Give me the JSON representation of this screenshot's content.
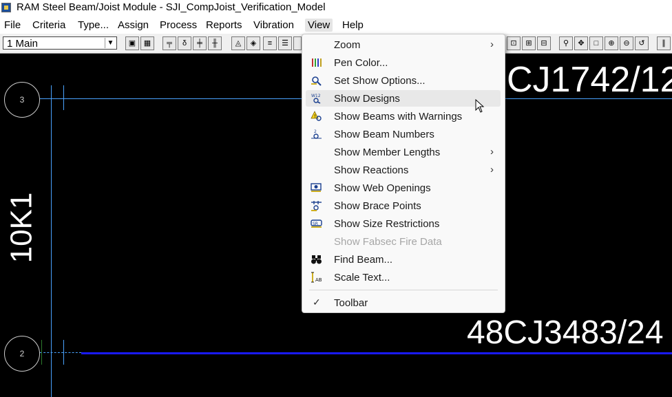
{
  "window": {
    "title": "RAM Steel Beam/Joist Module - SJI_CompJoist_Verification_Model"
  },
  "menubar": {
    "items": [
      "File",
      "Criteria",
      "Type...",
      "Assign",
      "Process",
      "Reports",
      "Vibration",
      "View",
      "Help"
    ],
    "active": "View"
  },
  "toolbar": {
    "story_value": "1   Main"
  },
  "canvas": {
    "grid_bubbles": [
      "3",
      "2"
    ],
    "beam_label_top": "CJ1742/12",
    "beam_label_bottom": "48CJ3483/24",
    "joist_label": "10K1",
    "colors": {
      "background": "#000000",
      "grid": "#4aa3ff",
      "beam": "#1a1aff",
      "text": "#ffffff"
    }
  },
  "view_menu": {
    "items": [
      {
        "label": "Zoom",
        "icon": "none",
        "submenu": true
      },
      {
        "label": "Pen Color...",
        "icon": "pen-color-icon"
      },
      {
        "label": "Set Show Options...",
        "icon": "show-options-icon"
      },
      {
        "label": "Show Designs",
        "icon": "show-designs-icon",
        "hover": true
      },
      {
        "label": "Show Beams with Warnings",
        "icon": "warning-icon"
      },
      {
        "label": "Show Beam Numbers",
        "icon": "beam-numbers-icon"
      },
      {
        "label": "Show Member Lengths",
        "icon": "none",
        "submenu": true
      },
      {
        "label": "Show Reactions",
        "icon": "none",
        "submenu": true
      },
      {
        "label": "Show Web Openings",
        "icon": "web-openings-icon"
      },
      {
        "label": "Show Brace Points",
        "icon": "brace-points-icon"
      },
      {
        "label": "Show Size Restrictions",
        "icon": "size-restrictions-icon"
      },
      {
        "label": "Show Fabsec Fire Data",
        "icon": "none",
        "disabled": true
      },
      {
        "label": "Find Beam...",
        "icon": "binoculars-icon"
      },
      {
        "label": "Scale Text...",
        "icon": "scale-text-icon"
      },
      {
        "label": "Toolbar",
        "icon": "check-icon",
        "checked": true
      }
    ]
  }
}
